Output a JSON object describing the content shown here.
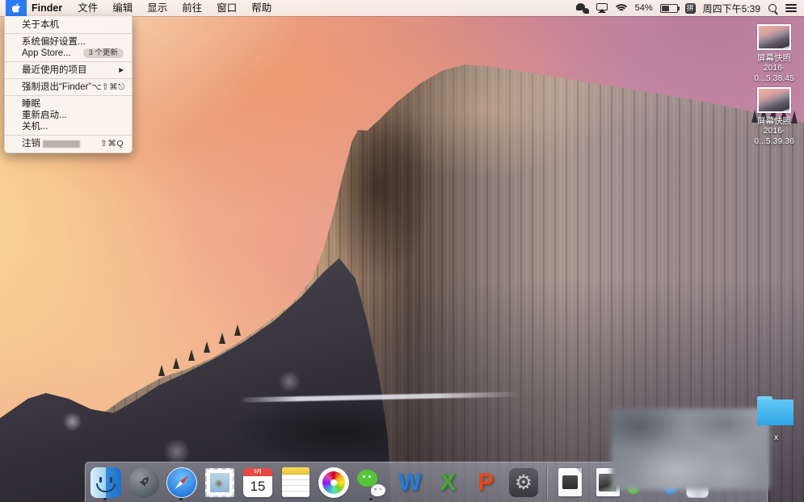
{
  "menu_bar": {
    "app_title": "Finder",
    "menus": [
      "文件",
      "编辑",
      "显示",
      "前往",
      "窗口",
      "帮助"
    ],
    "status": {
      "battery_percent": "54%",
      "input_method": "拼",
      "clock": "周四下午5:39"
    }
  },
  "apple_menu": {
    "items": [
      {
        "label": "关于本机"
      },
      {
        "label": "系统偏好设置..."
      },
      {
        "label": "App Store...",
        "badge": "3 个更新"
      },
      {
        "label": "最近使用的项目",
        "arrow": "▶"
      },
      {
        "label": "强制退出“Finder”",
        "shortcut": "⌥⇧⌘⎋"
      },
      {
        "label": "睡眠"
      },
      {
        "label": "重新启动..."
      },
      {
        "label": "关机..."
      },
      {
        "label": "注销",
        "shortcut": "⇧⌘Q",
        "redacted_user": true
      }
    ]
  },
  "desktop": {
    "files": [
      {
        "label_line1": "屏幕快照",
        "label_line2": "2016-0...5.38.45"
      },
      {
        "label_line1": "屏幕快照",
        "label_line2": "2016-0...5.39.36"
      }
    ],
    "folder_label": "x"
  },
  "dock": {
    "items": [
      {
        "name": "finder"
      },
      {
        "name": "launchpad"
      },
      {
        "name": "safari"
      },
      {
        "name": "mail"
      },
      {
        "name": "calendar",
        "month": "9月",
        "day": "15"
      },
      {
        "name": "notes"
      },
      {
        "name": "photos"
      },
      {
        "name": "wechat"
      },
      {
        "name": "word",
        "letter": "W"
      },
      {
        "name": "excel",
        "letter": "X"
      },
      {
        "name": "powerpoint",
        "letter": "P"
      },
      {
        "name": "system-preferences",
        "glyph": "⚙"
      },
      {
        "name": "document-installer"
      },
      {
        "name": "document-screenshot"
      },
      {
        "name": "trash"
      }
    ],
    "running_indicators": [
      "finder",
      "safari",
      "wechat"
    ]
  },
  "colors": {
    "menu_highlight_blue": "#2b7cf6",
    "folder_blue": "#3fb6ee",
    "calendar_red": "#e8483f",
    "wechat_green": "#55c538",
    "badge_gray": "#d8d2ca"
  }
}
